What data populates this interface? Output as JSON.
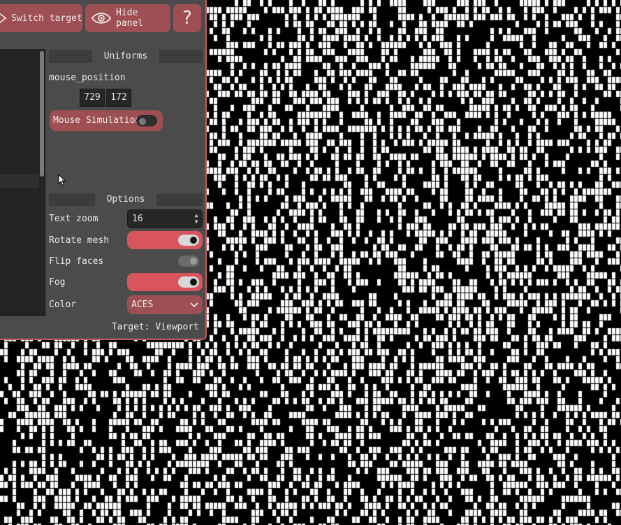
{
  "toolbar": {
    "switch_target_label": "Switch target",
    "hide_panel_label": "Hide panel",
    "help_label": "?"
  },
  "uniforms": {
    "title": "Uniforms",
    "mouse_position_label": "mouse_position",
    "mouse_x": "729",
    "mouse_y": "172",
    "mouse_simulation_label": "Mouse Simulation",
    "mouse_simulation_on": false
  },
  "options": {
    "title": "Options",
    "text_zoom_label": "Text zoom",
    "text_zoom_value": "16",
    "rotate_mesh_label": "Rotate mesh",
    "rotate_mesh_on": true,
    "flip_faces_label": "Flip faces",
    "flip_faces_on": true,
    "fog_label": "Fog",
    "fog_on": true,
    "color_label": "Color",
    "color_value": "ACES"
  },
  "status": {
    "target_label": "Target: Viewport"
  },
  "colors": {
    "panel_bg": "#4b4b4b",
    "accent": "#d8555d",
    "button_bg": "#9d4f54",
    "viewport_bg": "#000000",
    "viewport_fg": "#ffffff"
  },
  "icons": {
    "switch_target": "arrow-right-icon",
    "hide_panel": "eye-icon",
    "help": "question-mark",
    "color_dropdown": "chevron-down-icon",
    "spinner": "up-down-arrows-icon"
  }
}
